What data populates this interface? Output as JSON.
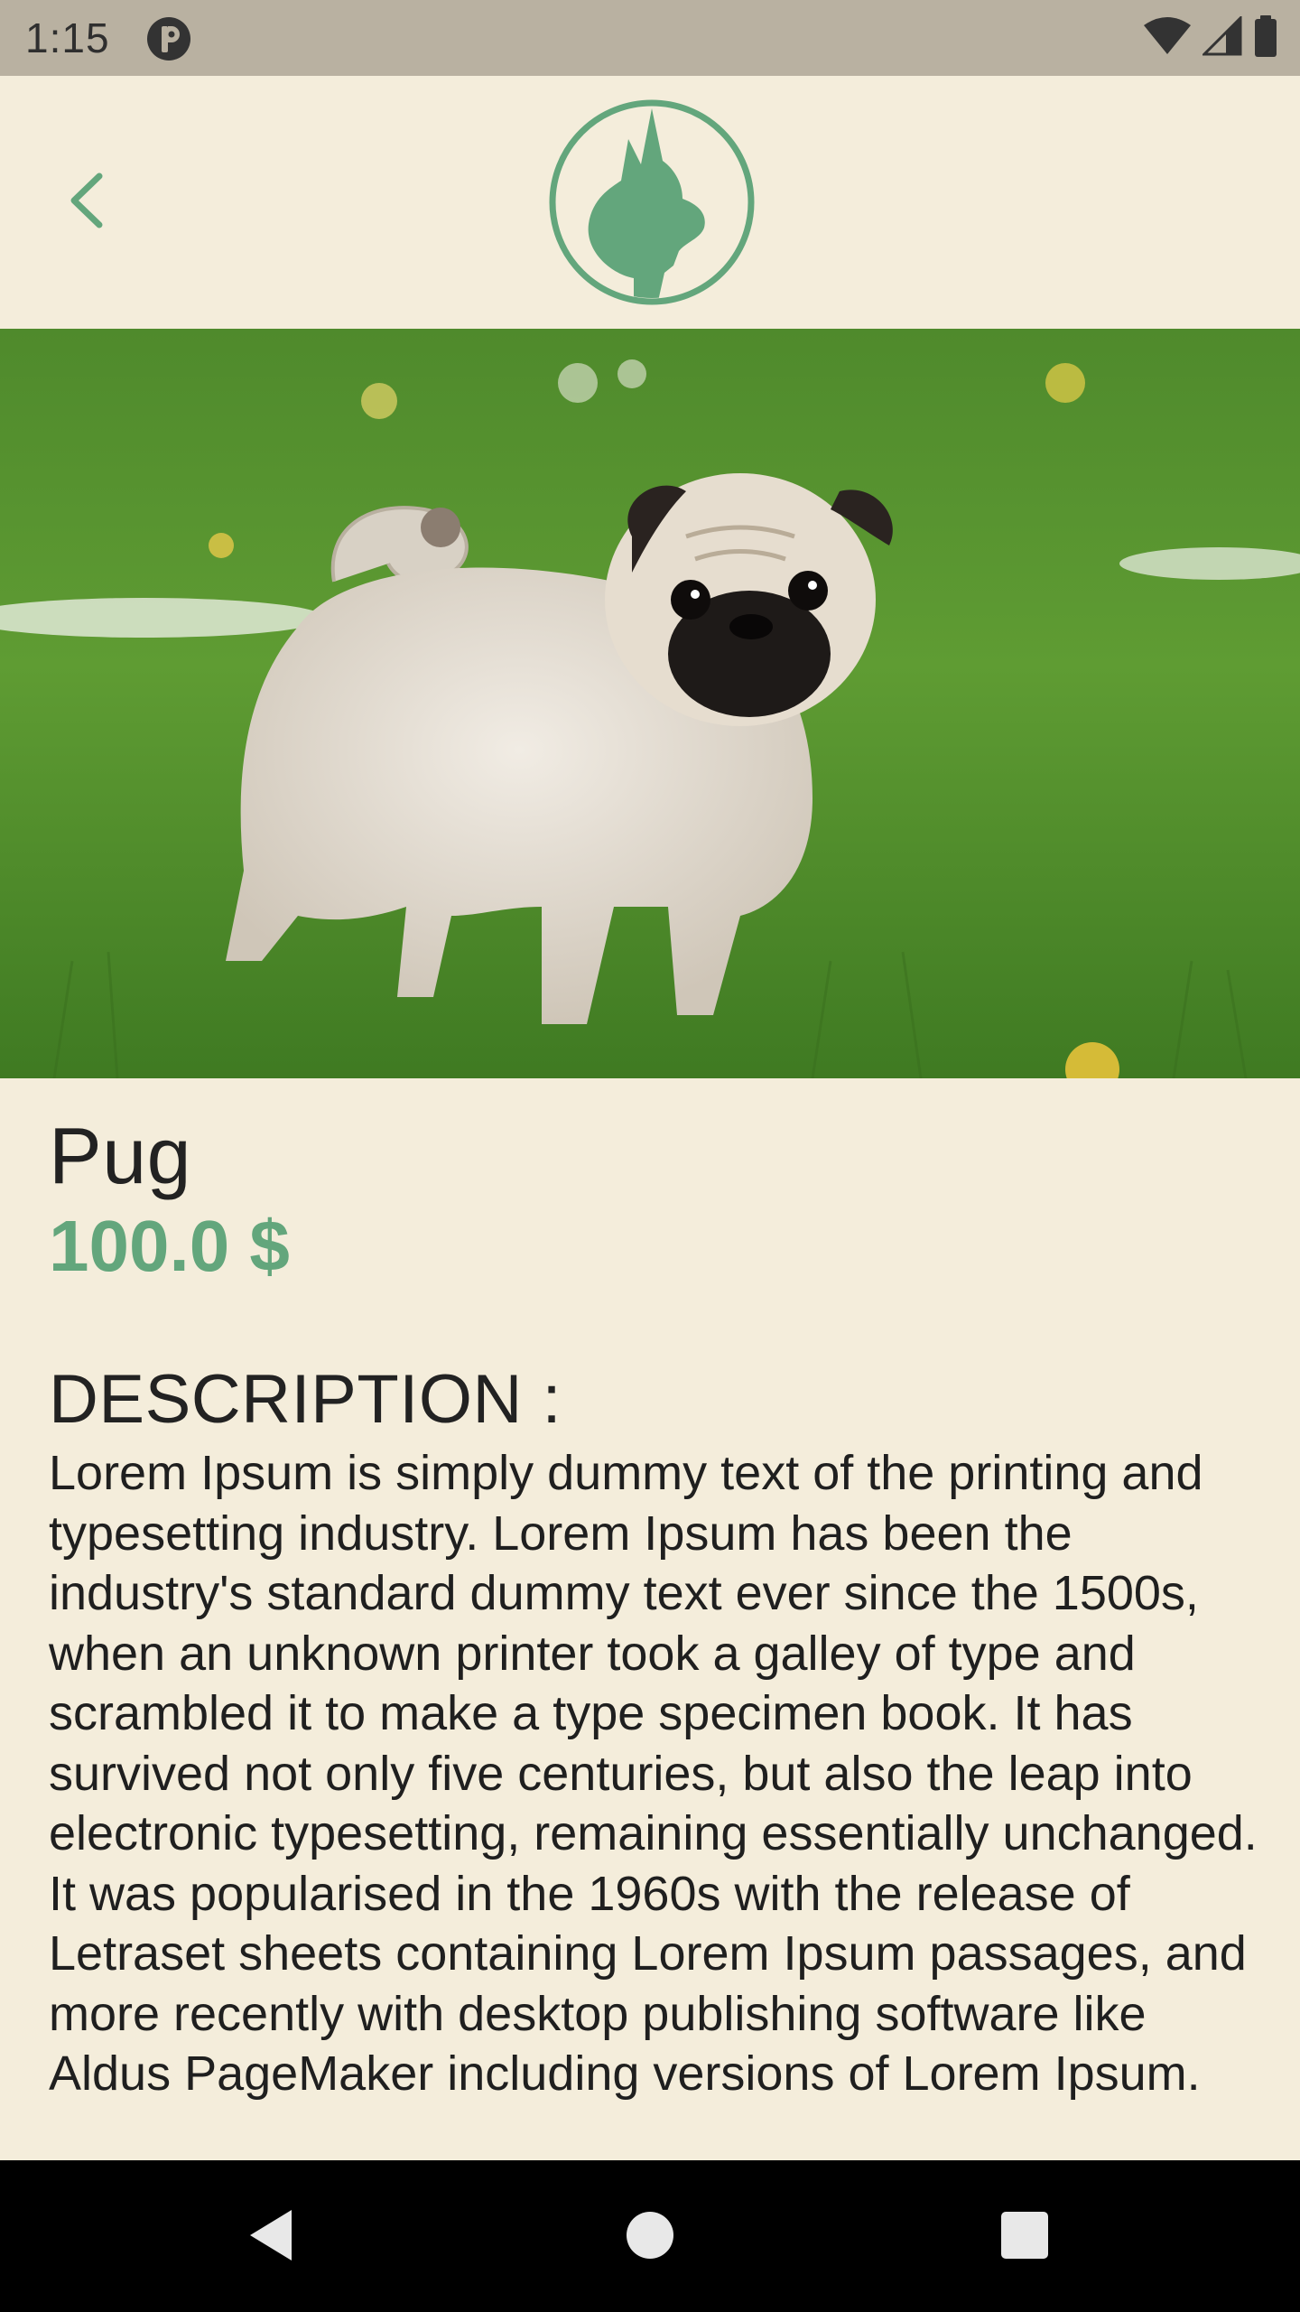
{
  "status_bar": {
    "time": "1:15",
    "icons": [
      "app-notification-icon",
      "wifi-icon",
      "cell-signal-icon",
      "battery-icon"
    ]
  },
  "app_bar": {
    "back_icon": "chevron-left-icon",
    "logo_icon": "cat-head-logo-icon",
    "accent_color": "#63a67c"
  },
  "hero": {
    "image_subject": "pug-dog-photo"
  },
  "product": {
    "name": "Pug",
    "price": "100.0 $",
    "description_heading": "DESCRIPTION :",
    "description": "Lorem Ipsum is simply dummy text of the printing and typesetting industry. Lorem Ipsum has been the industry's standard dummy text ever since the 1500s, when an unknown printer took a galley of type and scrambled it to make a type specimen book. It has survived not only five centuries, but also the leap into electronic typesetting, remaining essentially unchanged. It was popularised in the 1960s with the release of Letraset sheets containing Lorem Ipsum passages, and more recently with desktop publishing software like Aldus PageMaker including versions of Lorem Ipsum."
  },
  "nav_bar": {
    "buttons": [
      "back-triangle-icon",
      "home-circle-icon",
      "recents-square-icon"
    ]
  }
}
